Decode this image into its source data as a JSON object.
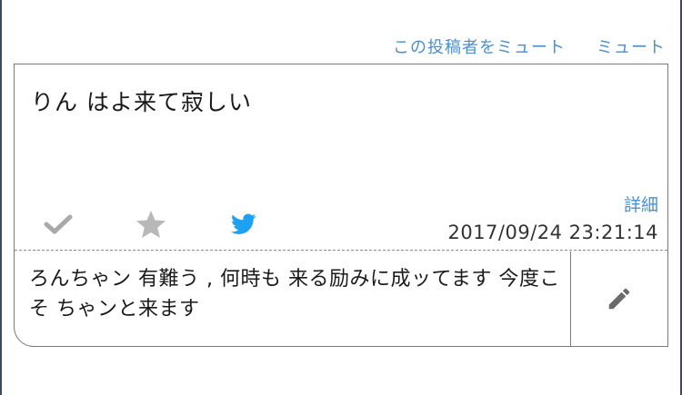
{
  "header": {
    "mute_poster_label": "この投稿者をミュート",
    "mute_label": "ミュート"
  },
  "post": {
    "text": "りん はよ来て寂しい",
    "detail_label": "詳細",
    "timestamp": "2017/09/24 23:21:14",
    "actions": [
      {
        "icon": "check-icon",
        "color": "#a9a9a9"
      },
      {
        "icon": "star-icon",
        "color": "#b8b8b8"
      },
      {
        "icon": "twitter-bird-icon",
        "color": "#1da1f2"
      }
    ]
  },
  "reply": {
    "text": "ろんちゃン 有難う , 何時も 来る励みに成ッてます 今度こそ ちゃンと来ます"
  },
  "colors": {
    "link": "#4a8fd0",
    "border": "#7a7a7a",
    "frame": "#3a4a66"
  }
}
